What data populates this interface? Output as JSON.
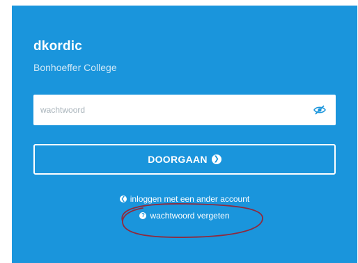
{
  "account": {
    "username": "dkordic",
    "school": "Bonhoeffer College"
  },
  "password": {
    "placeholder": "wachtwoord",
    "value": "",
    "toggle_icon": "eye-slash-icon"
  },
  "continue_button": {
    "label": "DOORGAAN",
    "icon": "arrow-circle-right-icon",
    "icon_glyph": "❯"
  },
  "links": {
    "other_account": {
      "label": "inloggen met een ander account",
      "icon": "arrow-circle-left-icon",
      "icon_glyph": "❮"
    },
    "forgot_password": {
      "label": "wachtwoord vergeten",
      "icon": "question-circle-icon",
      "icon_glyph": "?"
    }
  },
  "colors": {
    "card_background": "#1a95dc",
    "text": "#ffffff",
    "annotation_circle": "#8e2a3e"
  }
}
